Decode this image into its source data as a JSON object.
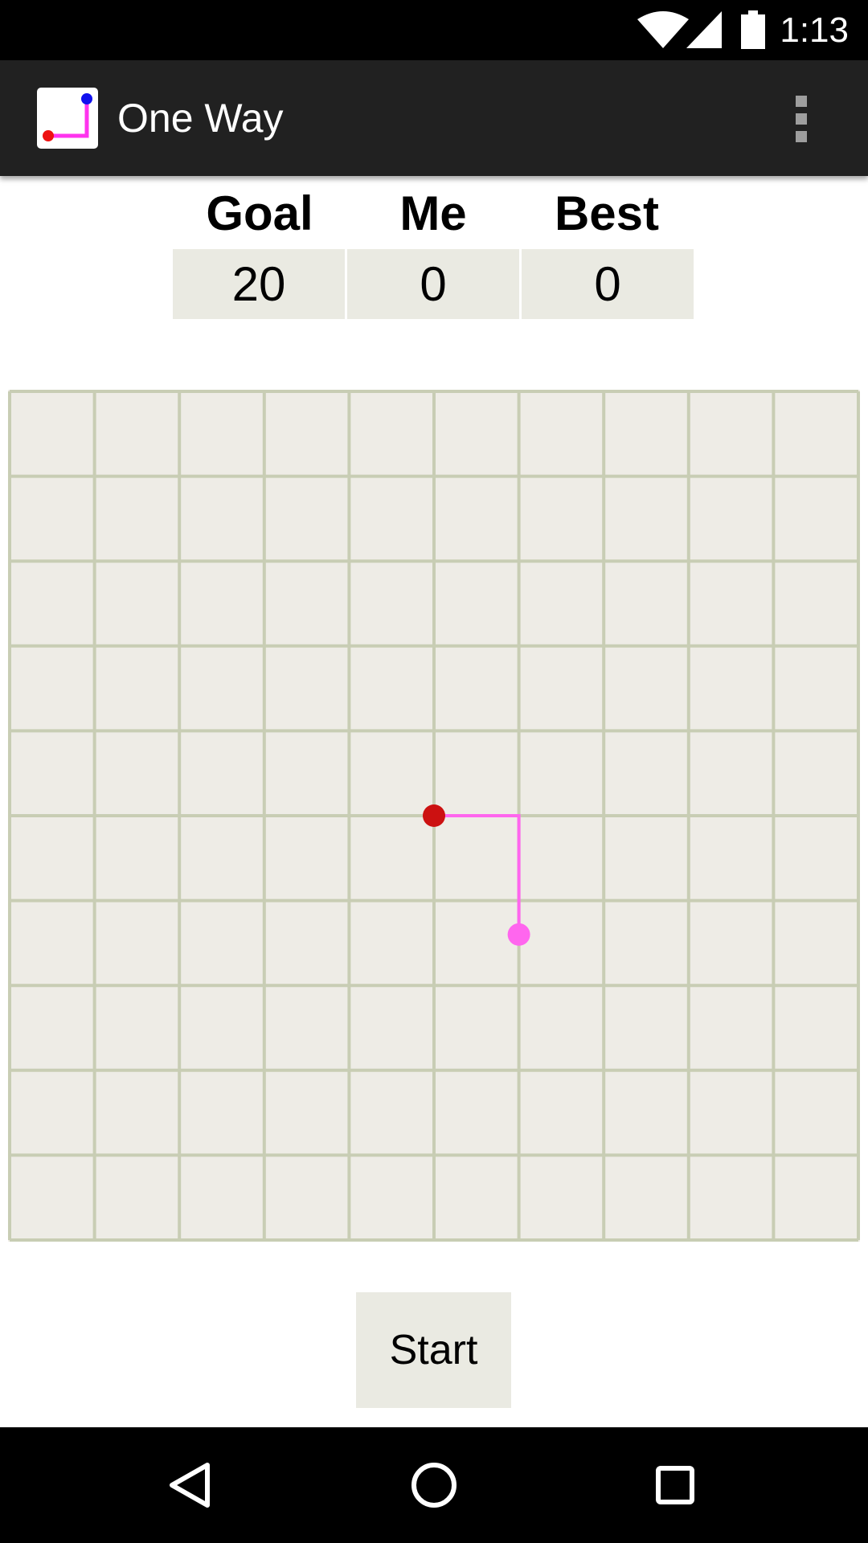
{
  "status_bar": {
    "time": "1:13",
    "icons": [
      "wifi-icon",
      "cell-signal-icon",
      "battery-icon"
    ]
  },
  "app_bar": {
    "title": "One Way",
    "app_icon": "one-way-app-icon",
    "menu_icon": "overflow-menu-icon"
  },
  "scores": {
    "goal_label": "Goal",
    "me_label": "Me",
    "best_label": "Best",
    "goal": "20",
    "me": "0",
    "best": "0"
  },
  "board": {
    "rows": 10,
    "cols": 10,
    "colors": {
      "cell": "#eeece6",
      "grid_line": "#c8cdb4",
      "path": "#ff66ee",
      "start_dot": "#cc1111",
      "end_dot": "#ff66ee"
    },
    "path": [
      [
        5,
        5
      ],
      [
        6,
        5
      ],
      [
        6,
        6.4
      ]
    ],
    "start_point": [
      5,
      5
    ],
    "end_point": [
      6,
      6.4
    ]
  },
  "controls": {
    "start_label": "Start"
  },
  "nav_bar": {
    "icons": [
      "back-icon",
      "home-icon",
      "recents-icon"
    ]
  }
}
